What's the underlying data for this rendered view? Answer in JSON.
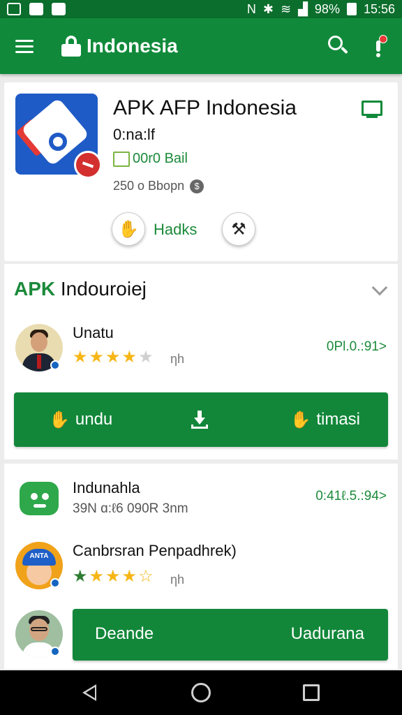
{
  "status_bar": {
    "battery": "98%",
    "time": "15:56"
  },
  "app_bar": {
    "title": "Indonesia"
  },
  "app_card": {
    "name": "APK AFP Indonesia",
    "subtitle": "0:na:lf",
    "category": "00r0 Bail",
    "meta": "250 o Bbopn",
    "action_label": "Hadks"
  },
  "section": {
    "title_prefix": "APK",
    "title_rest": " Indouroiej"
  },
  "rows": [
    {
      "name": "Unatu",
      "rating": 4,
      "rating_tail": "ηh",
      "right": "0Pl.0.:91>"
    }
  ],
  "action_bar": {
    "left_label": "undu",
    "right_label": "timasi"
  },
  "list2": [
    {
      "name": "Indunahla",
      "sub": "39N ɑ:ℓ6 090R 3nm",
      "right": "0:41ℓ.5.:94>"
    },
    {
      "name": "Canbrsran Penpadhrek)",
      "rating": 4,
      "rating_tail": "ηh",
      "cap_text": "ANTA"
    }
  ],
  "bottom_bar": {
    "left_label": "Deande",
    "right_label": "Uadurana"
  },
  "colors": {
    "primary": "#108a3a",
    "status": "#0b6e2c",
    "accent_text": "#1b8a3a",
    "star": "#f6b617"
  }
}
